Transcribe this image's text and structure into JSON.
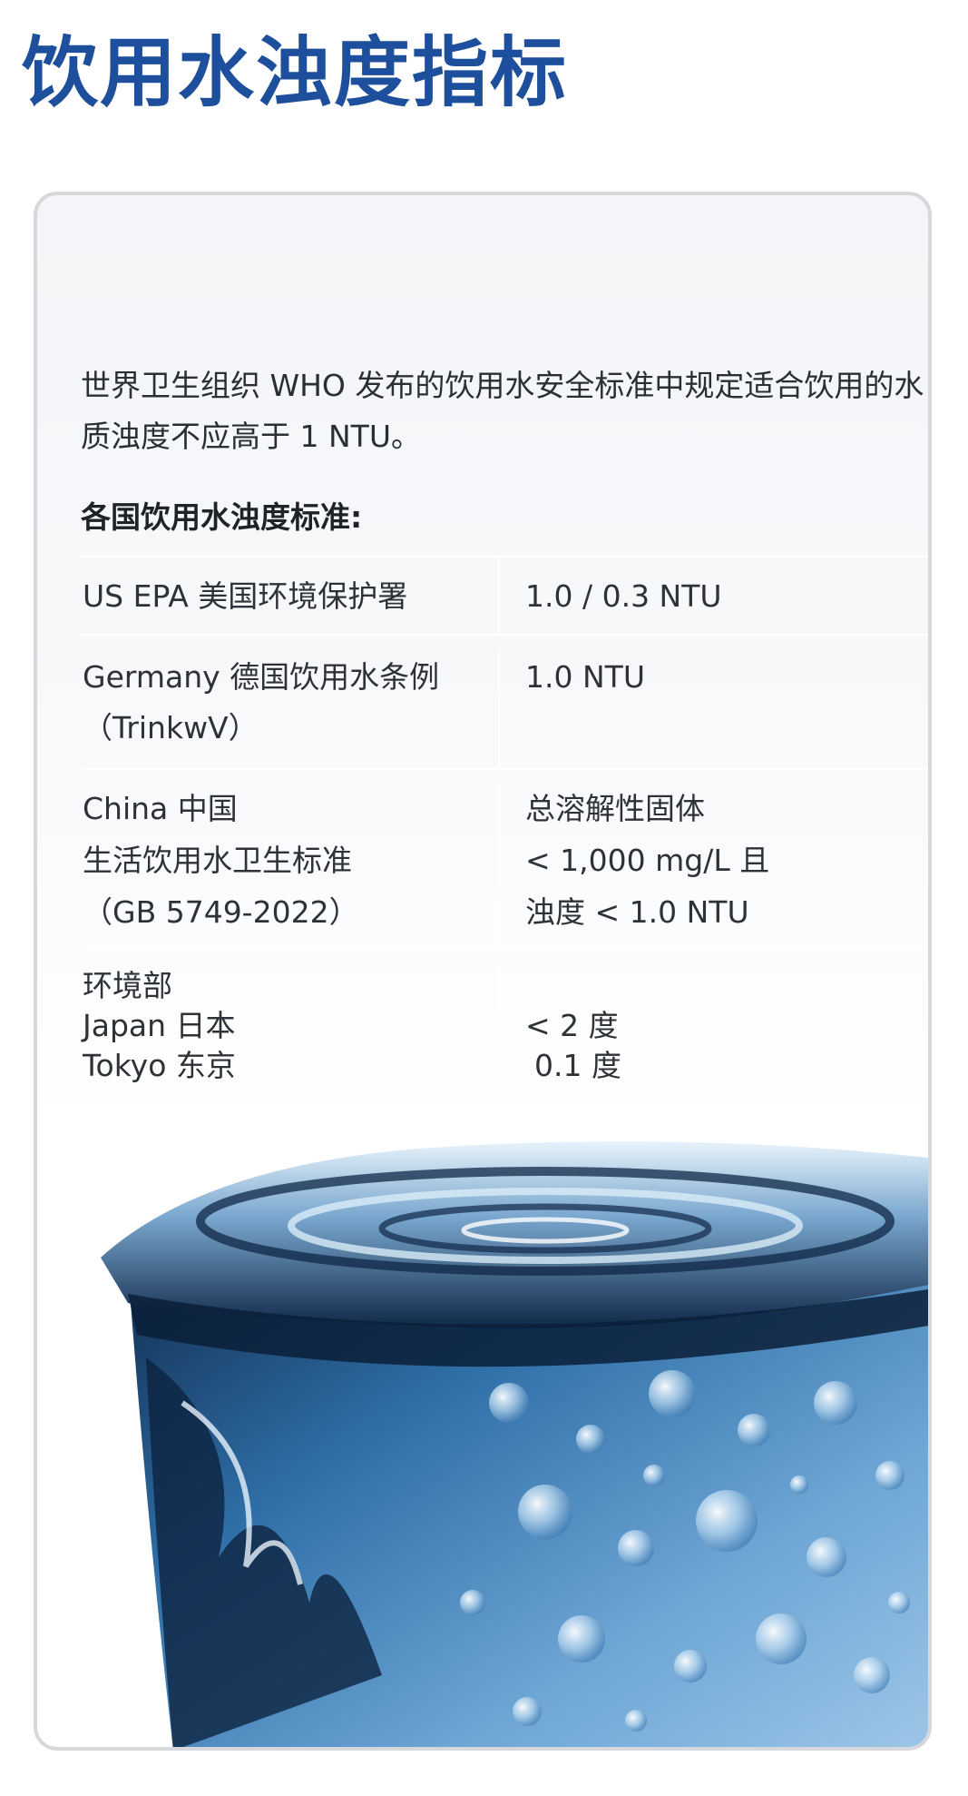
{
  "page": {
    "title": "饮用水浊度指标"
  },
  "intro": {
    "text": "世界卫生组织 WHO 发布的饮用水安全标准中规定适合饮用的水质浊度不应高于 1 NTU。"
  },
  "table": {
    "heading": "各国饮用水浊度标准:",
    "rows": [
      {
        "left": [
          "US EPA 美国环境保护署"
        ],
        "right": [
          "1.0 / 0.3 NTU"
        ]
      },
      {
        "left": [
          "Germany 德国饮用水条例",
          "（TrinkwV）"
        ],
        "right": [
          "1.0 NTU"
        ]
      },
      {
        "left": [
          "China 中国",
          "生活饮用水卫生标准",
          "（GB 5749-2022）"
        ],
        "right": [
          "总溶解性固体",
          "< 1,000 mg/L 且",
          "浊度 < 1.0 NTU"
        ]
      },
      {
        "left": [
          "环境部",
          "Japan 日本",
          "Tokyo 东京"
        ],
        "right": [
          "< 2 度",
          "0.1 度"
        ]
      }
    ]
  },
  "image": {
    "subject": "glass-of-water",
    "colors": {
      "deep": "#0f2747",
      "mid": "#2f6fa8",
      "light": "#9cc6e8",
      "highlight": "#e8f3fb"
    }
  }
}
